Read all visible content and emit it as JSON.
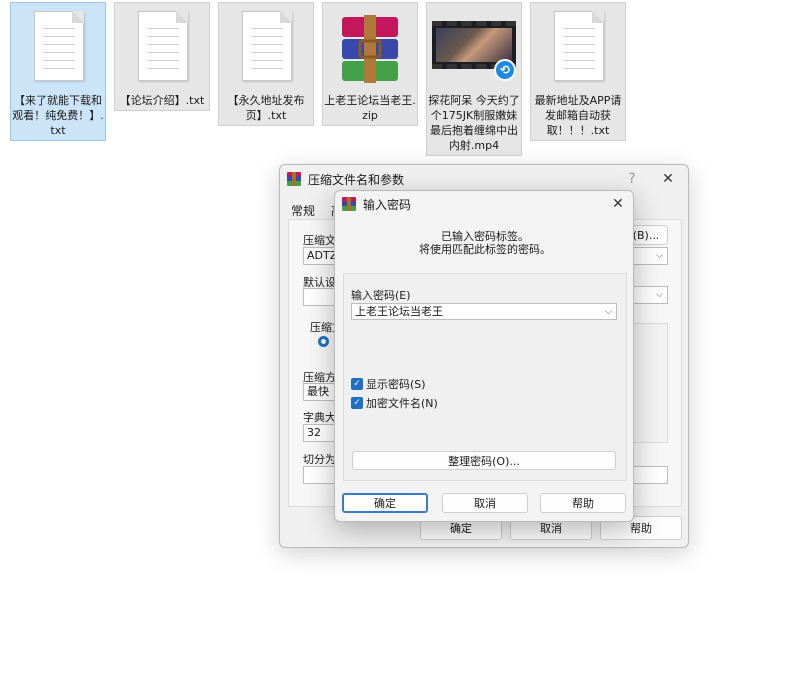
{
  "files": [
    {
      "name": "【来了就能下载和观看！纯免费！】.txt",
      "type": "txt",
      "selected": true
    },
    {
      "name": "【论坛介绍】.txt",
      "type": "txt"
    },
    {
      "name": "【永久地址发布页】.txt",
      "type": "txt"
    },
    {
      "name": "上老王论坛当老王.zip",
      "type": "zip"
    },
    {
      "name": "探花阿呆 今天约了个175JK制服嫩妹最后抱着缠绵中出内射.mp4",
      "type": "video"
    },
    {
      "name": "最新地址及APP请发邮箱自动获取！！！.txt",
      "type": "txt"
    }
  ],
  "main_dialog": {
    "title": "压缩文件名和参数",
    "help_glyph": "?",
    "close_glyph": "✕",
    "tabs": [
      "常规",
      "高"
    ],
    "archive_name_label": "压缩文",
    "archive_name_value": "ADTZF",
    "browse_label": "(B)...",
    "default_settings_label": "默认设",
    "format_label": "压缩文",
    "method_label": "压缩方",
    "method_value": "最快",
    "dict_label": "字典大小",
    "dict_value": "32",
    "split_label": "切分为分",
    "ok_label": "确定",
    "cancel_label": "取消",
    "help_label": "帮助"
  },
  "password_dialog": {
    "title": "输入密码",
    "close_glyph": "✕",
    "info_line1": "已输入密码标签。",
    "info_line2": "将使用匹配此标签的密码。",
    "password_label": "输入密码(E)",
    "password_value": "上老王论坛当老王",
    "show_password_label": "显示密码(S)",
    "encrypt_names_label": "加密文件名(N)",
    "organize_label": "整理密码(O)...",
    "ok_label": "确定",
    "cancel_label": "取消",
    "help_label": "帮助"
  },
  "colors": {
    "accent": "#1f6fc5",
    "selection": "#cce4f7"
  }
}
